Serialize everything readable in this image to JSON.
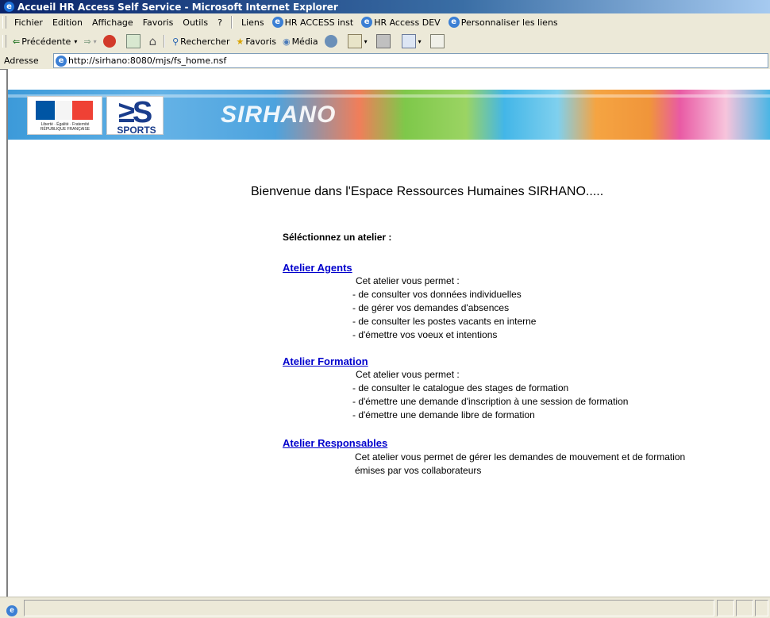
{
  "window": {
    "title": "Accueil HR Access Self Service - Microsoft Internet Explorer"
  },
  "menubar": {
    "items": [
      "Fichier",
      "Edition",
      "Affichage",
      "Favoris",
      "Outils",
      "?"
    ],
    "links_label": "Liens",
    "links": [
      "HR ACCESS inst",
      "HR Access DEV",
      "Personnaliser les liens"
    ]
  },
  "toolbar": {
    "back_label": "Précédente",
    "search_label": "Rechercher",
    "favorites_label": "Favoris",
    "media_label": "Média"
  },
  "address": {
    "label": "Adresse",
    "url": "http://sirhano:8080/mjs/fs_home.nsf"
  },
  "banner": {
    "republique_text": "Liberté · Égalité · Fraternité RÉPUBLIQUE FRANÇAISE",
    "sports_label": "SPORTS",
    "brand": "SIRHANO"
  },
  "main": {
    "welcome": "Bienvenue dans l'Espace Ressources Humaines SIRHANO.....",
    "select_prompt": "Séléctionnez un atelier :",
    "ateliers": [
      {
        "title": "Atelier Agents",
        "lines": [
          "Cet atelier vous permet :",
          "- de consulter vos données individuelles",
          "- de gérer vos demandes d'absences",
          "- de consulter les postes vacants en interne",
          "- d'émettre vos voeux et intentions"
        ]
      },
      {
        "title": "Atelier Formation",
        "lines": [
          "Cet atelier vous permet :",
          "- de consulter le catalogue des stages de formation",
          "- d'émettre une demande d'inscription à une session de formation",
          "- d'émettre une demande libre de formation"
        ]
      },
      {
        "title": "Atelier Responsables",
        "lines": [
          "Cet atelier vous permet de gérer les demandes de mouvement et de formation",
          "émises par vos collaborateurs"
        ]
      }
    ]
  },
  "colors": {
    "link": "#0000cc",
    "chrome": "#ece9d8",
    "titlebar": "#0a246a"
  }
}
